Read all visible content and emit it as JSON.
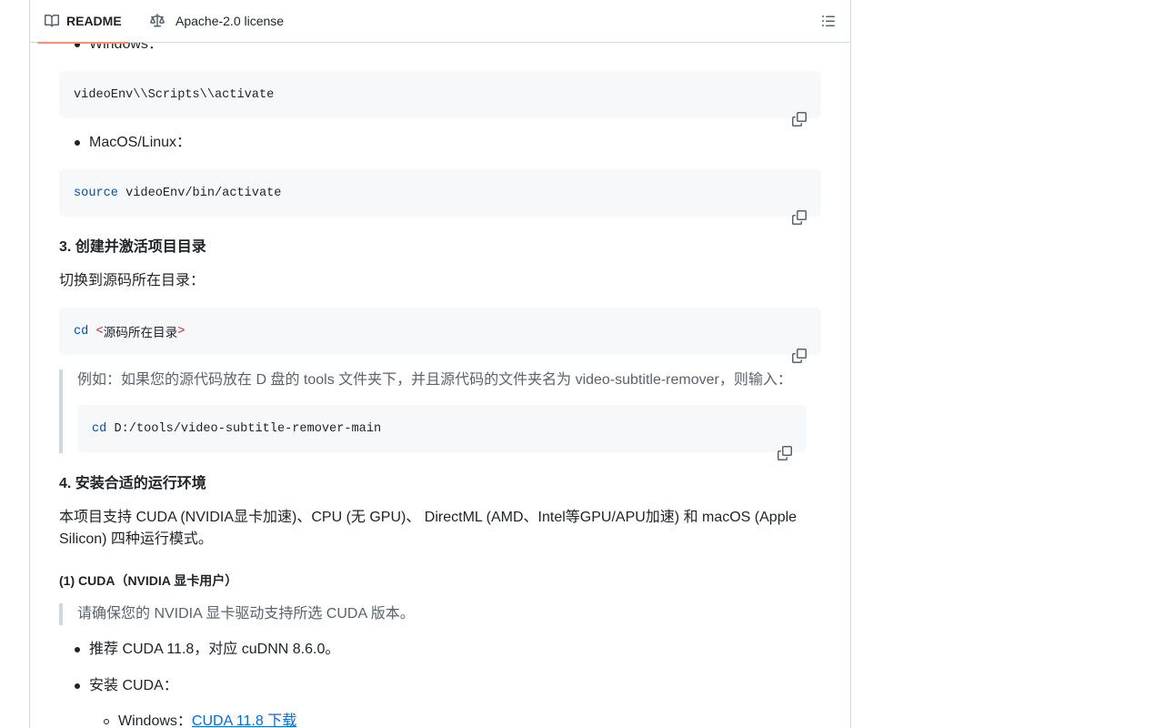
{
  "tabs": {
    "readme_label": "README",
    "license_label": "Apache-2.0 license"
  },
  "content": {
    "windows_item": "Windows：",
    "windows_code": "videoEnv\\\\Scripts\\\\activate",
    "mac_item": "MacOS/Linux：",
    "mac_code_kw": "source",
    "mac_code_rest": " videoEnv/bin/activate",
    "heading3": "3. 创建并激活项目目录",
    "para3": "切换到源码所在目录：",
    "cd_kw": "cd",
    "cd_open": "<",
    "cd_arg": "源码所在目录",
    "cd_close": ">",
    "quote1_text": "例如：如果您的源代码放在 D 盘的 tools 文件夹下，并且源代码的文件夹名为 video-subtitle-remover，则输入：",
    "quote1_code_kw": "cd",
    "quote1_code_rest": " D:/tools/video-subtitle-remover-main",
    "heading4": "4. 安装合适的运行环境",
    "para4": "本项目支持 CUDA (NVIDIA显卡加速)、CPU (无 GPU)、 DirectML (AMD、Intel等GPU/APU加速) 和 macOS (Apple Silicon) 四种运行模式。",
    "heading5": "(1) CUDA（NVIDIA 显卡用户）",
    "quote2_text": "请确保您的 NVIDIA 显卡驱动支持所选 CUDA 版本。",
    "bullet_recommend": "推荐 CUDA 11.8，对应 cuDNN 8.6.0。",
    "bullet_install": "安装 CUDA：",
    "sub_windows_label": "Windows：",
    "sub_windows_link": "CUDA 11.8 下载"
  },
  "icons": {
    "readme": "book-icon",
    "license": "law-scale-icon",
    "outline": "list-unordered-icon",
    "copy": "copy-icon"
  },
  "colors": {
    "accent_tab_underline": "#fd8c73",
    "link": "#0969da",
    "code_bg": "#f6f8fa",
    "keyword": "#0550ae",
    "angle_bracket": "#cf222e",
    "quote_text": "#59636e"
  }
}
